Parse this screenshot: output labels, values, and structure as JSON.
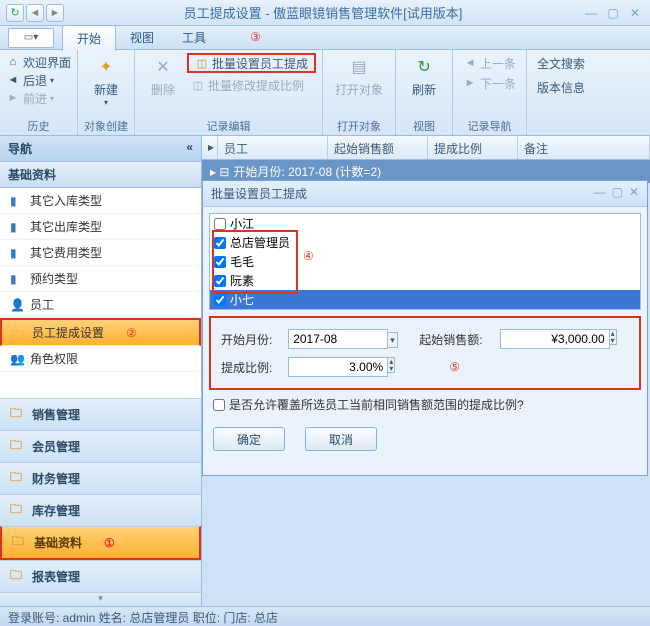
{
  "window": {
    "title": "员工提成设置 - 傲蓝眼镜销售管理软件[试用版本]"
  },
  "menu": {
    "tabs": [
      "开始",
      "视图",
      "工具"
    ]
  },
  "ribbon": {
    "nav": {
      "welcome": "欢迎界面",
      "back": "后退",
      "forward": "前进",
      "group": "历史"
    },
    "create": {
      "new": "新建",
      "group": "对象创建"
    },
    "edit": {
      "delete": "删除",
      "batch_set": "批量设置员工提成",
      "batch_mod": "批量修改提成比例",
      "group": "记录编辑"
    },
    "open": {
      "open": "打开对象",
      "group": "打开对象"
    },
    "view": {
      "refresh": "刷新",
      "group": "视图"
    },
    "recnav": {
      "prev": "上一条",
      "next": "下一条",
      "group": "记录导航"
    },
    "search": {
      "fulltext": "全文搜索"
    },
    "version": {
      "info": "版本信息"
    }
  },
  "sidebar": {
    "title": "导航",
    "section": "基础资料",
    "tree": [
      "其它入库类型",
      "其它出库类型",
      "其它费用类型",
      "预约类型",
      "员工",
      "员工提成设置",
      "角色权限"
    ],
    "folders": [
      "销售管理",
      "会员管理",
      "财务管理",
      "库存管理",
      "基础资料",
      "报表管理"
    ]
  },
  "grid": {
    "cols": [
      "员工",
      "起始销售额",
      "提成比例",
      "备注"
    ],
    "grouprow": "开始月份: 2017-08 (计数=2)"
  },
  "dialog": {
    "title": "批量设置员工提成",
    "employees": [
      "小江",
      "总店管理员",
      "毛毛",
      "阮素",
      "小七"
    ],
    "start_month_label": "开始月份:",
    "start_month": "2017-08",
    "start_sales_label": "起始销售额:",
    "start_sales": "¥3,000.00",
    "ratio_label": "提成比例:",
    "ratio": "3.00%",
    "overwrite": "是否允许覆盖所选员工当前相同销售额范围的提成比例?",
    "ok": "确定",
    "cancel": "取消"
  },
  "status": {
    "text": "登录账号: admin  姓名: 总店管理员  职位:   门店: 总店"
  },
  "anno": {
    "a1": "①",
    "a2": "②",
    "a3": "③",
    "a4": "④",
    "a5": "⑤"
  }
}
